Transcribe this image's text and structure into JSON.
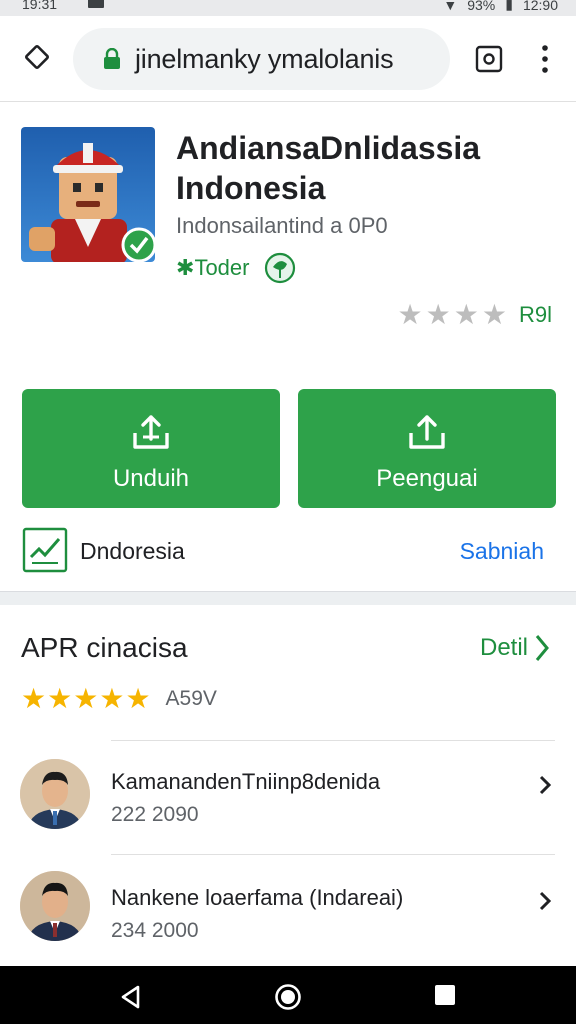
{
  "status_bar": {
    "time": "19:31",
    "battery_text": "93%",
    "clock_right": "12:90"
  },
  "browser": {
    "url": "jinelmanky ymalolanis",
    "icons": {
      "nav": "diamond-nav-icon",
      "secure": "lock-icon",
      "tabs": "tabs-icon",
      "menu": "kebab-menu-icon"
    }
  },
  "app": {
    "title": "AndiansaDnlidassia Indonesia",
    "subtitle": "Indonsailantind a 0P0",
    "developer_label": "Toder",
    "rating_text": "R9l",
    "rating_stars": 4
  },
  "actions": {
    "download_label": "Unduih",
    "install_label": "Peenguai"
  },
  "country": {
    "label": "Dndoresia",
    "link": "Sabniah"
  },
  "reviews": {
    "title": "APR cinacisa",
    "detail_link": "Detil",
    "stars": 5,
    "stars_text": "A59V",
    "items": [
      {
        "name": "KamanandenTniinp8denida",
        "date": "222 2090"
      },
      {
        "name": "Nankene loaerfama (Indareai)",
        "date": "234 2000"
      }
    ]
  },
  "colors": {
    "accent_green": "#2ea24a",
    "link_blue": "#1a73e8",
    "star_gold": "#f6b400",
    "star_gray": "#bdbdbd"
  }
}
